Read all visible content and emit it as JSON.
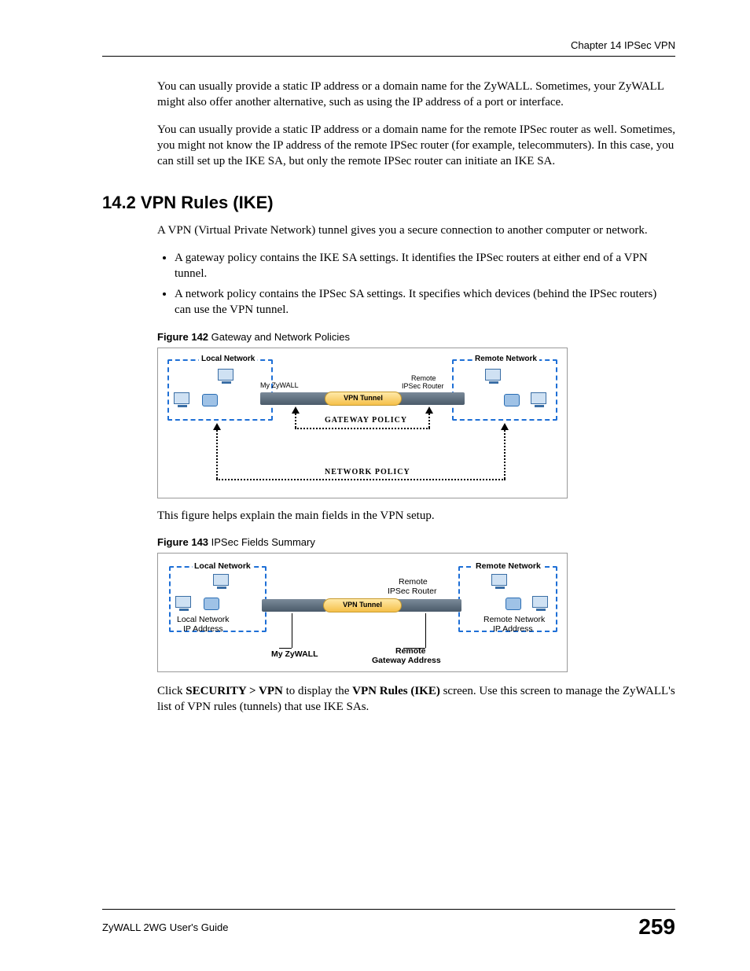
{
  "header": {
    "chapter": "Chapter 14 IPSec VPN"
  },
  "para1": "You can usually provide a static IP address or a domain name for the ZyWALL. Sometimes, your ZyWALL might also offer another alternative, such as using the IP address of a port or interface.",
  "para2": "You can usually provide a static IP address or a domain name for the remote IPSec router as well. Sometimes, you might not know the IP address of the remote IPSec router (for example, telecommuters). In this case, you can still set up the IKE SA, but only the remote IPSec router can initiate an IKE SA.",
  "section_heading": "14.2  VPN Rules (IKE)",
  "para3": "A VPN (Virtual Private Network) tunnel gives you a secure connection to another computer or network.",
  "bullets": [
    "A gateway policy contains the IKE SA settings. It identifies the IPSec routers at either end of a VPN tunnel.",
    "A network policy contains the IPSec SA settings. It specifies which devices (behind the IPSec routers) can use the VPN tunnel."
  ],
  "fig142": {
    "label_bold": "Figure 142",
    "label_rest": "   Gateway and Network Policies",
    "local_network": "Local Network",
    "remote_network": "Remote Network",
    "my_zywall": "My ZyWALL",
    "remote_router_l1": "Remote",
    "remote_router_l2": "IPSec Router",
    "vpn_tunnel": "VPN Tunnel",
    "gateway_policy": "GATEWAY POLICY",
    "network_policy": "NETWORK POLICY"
  },
  "para4": "This figure helps explain the main fields in the VPN setup.",
  "fig143": {
    "label_bold": "Figure 143",
    "label_rest": "   IPSec Fields Summary",
    "local_network": "Local Network",
    "remote_network": "Remote Network",
    "remote_router_l1": "Remote",
    "remote_router_l2": "IPSec Router",
    "vpn_tunnel": "VPN Tunnel",
    "local_ip_l1": "Local Network",
    "local_ip_l2": "IP Address",
    "remote_ip_l1": "Remote Network",
    "remote_ip_l2": "IP Address",
    "my_zywall": "My ZyWALL",
    "remote_gw_l1": "Remote",
    "remote_gw_l2": "Gateway Address"
  },
  "para5_pre": "Click ",
  "para5_b1": "SECURITY > VPN",
  "para5_mid": " to display the ",
  "para5_b2": "VPN Rules (IKE)",
  "para5_post": " screen. Use this screen to manage the ZyWALL's list of VPN rules (tunnels) that use IKE SAs.",
  "footer": {
    "guide": "ZyWALL 2WG User's Guide",
    "page": "259"
  }
}
